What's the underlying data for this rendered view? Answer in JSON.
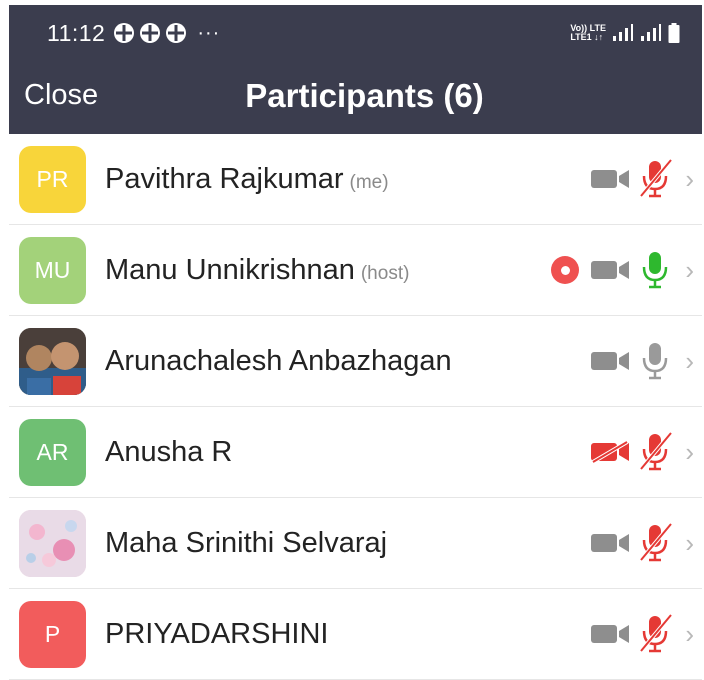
{
  "status_bar": {
    "time": "11:12",
    "notification_icons": [
      "app-icon",
      "app-icon",
      "app-icon"
    ],
    "more": "···",
    "network_line1": "Vo)) LTE",
    "network_line2": "LTE1 ↓↑"
  },
  "header": {
    "close_label": "Close",
    "title": "Participants (6)"
  },
  "colors": {
    "bar_bg": "#3b3d4e",
    "recording": "#ef5150",
    "mic_active": "#2eb82e",
    "muted_red": "#e53935"
  },
  "participants": [
    {
      "initials": "PR",
      "name": "Pavithra Rajkumar",
      "tag": "(me)",
      "avatar_color": "#f8d53a",
      "avatar_type": "initials",
      "recording": false,
      "video": "off",
      "mic": "muted"
    },
    {
      "initials": "MU",
      "name": "Manu Unnikrishnan",
      "tag": "(host)",
      "avatar_color": "#a3d27a",
      "avatar_type": "initials",
      "recording": true,
      "video": "off",
      "mic": "active"
    },
    {
      "initials": "",
      "name": "Arunachalesh Anbazhagan",
      "tag": "",
      "avatar_color": "#6b5a4e",
      "avatar_type": "photo",
      "recording": false,
      "video": "off",
      "mic": "idle"
    },
    {
      "initials": "AR",
      "name": "Anusha R",
      "tag": "",
      "avatar_color": "#6fbf73",
      "avatar_type": "initials",
      "recording": false,
      "video": "blocked",
      "mic": "muted"
    },
    {
      "initials": "",
      "name": "Maha Srinithi Selvaraj",
      "tag": "",
      "avatar_color": "#e8c8d8",
      "avatar_type": "flower-photo",
      "recording": false,
      "video": "off",
      "mic": "muted"
    },
    {
      "initials": "P",
      "name": "PRIYADARSHINI",
      "tag": "",
      "avatar_color": "#f25c5c",
      "avatar_type": "initials",
      "recording": false,
      "video": "off",
      "mic": "muted"
    }
  ]
}
